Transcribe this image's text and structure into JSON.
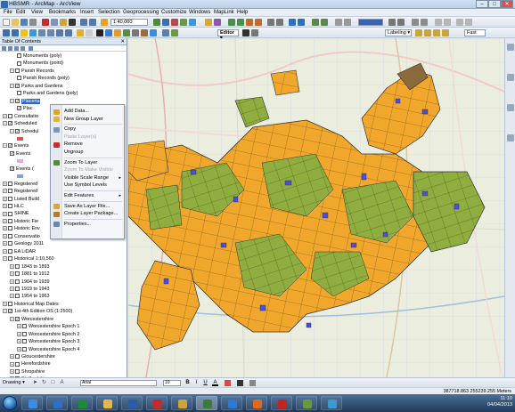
{
  "window": {
    "title": "HBSMR - ArcMap - ArcView",
    "minimize": "–",
    "maximize": "□",
    "close": "✕"
  },
  "menu": [
    "File",
    "Edit",
    "View",
    "Bookmarks",
    "Insert",
    "Selection",
    "Geoprocessing",
    "Customize",
    "Windows",
    "MapLink",
    "Help"
  ],
  "toolbar": {
    "scale": "1:40,000",
    "editor_label": "Editor ▾",
    "labeling_label": "Labeling ▾",
    "fast_label": "Fast"
  },
  "toc": {
    "title": "Table Of Contents",
    "close": "✕",
    "rows": [
      {
        "indent": 2,
        "pm": "",
        "cb": "",
        "label": "Monuments (poly)"
      },
      {
        "indent": 2,
        "pm": "",
        "cb": "",
        "label": "Monuments (point)"
      },
      {
        "indent": 1,
        "pm": "−",
        "cb": "",
        "label": "Parish Records"
      },
      {
        "indent": 2,
        "pm": "",
        "cb": "",
        "label": "Parish Records (poly)"
      },
      {
        "indent": 1,
        "pm": "−",
        "cb": "✓",
        "label": "Parks and Gardens"
      },
      {
        "indent": 2,
        "pm": "",
        "cb": "",
        "label": "Parks and Gardens (poly)"
      },
      {
        "indent": 1,
        "pm": "−",
        "cb": "✓",
        "label": "Placena",
        "sel": true
      },
      {
        "indent": 2,
        "pm": "",
        "cb": "✓",
        "label": "Plac"
      },
      {
        "indent": 0,
        "pm": "+",
        "cb": "",
        "label": "Consultatio"
      },
      {
        "indent": 0,
        "pm": "−",
        "cb": "✓",
        "label": "Scheduled"
      },
      {
        "indent": 1,
        "pm": "−",
        "cb": "✓",
        "label": "Schedul"
      },
      {
        "indent": 2,
        "pm": "",
        "cb": "",
        "label": "",
        "swatch": "#e84c4c"
      },
      {
        "indent": 0,
        "pm": "−",
        "cb": "✓",
        "label": "Events"
      },
      {
        "indent": 1,
        "pm": "",
        "cb": "✓",
        "label": "Events"
      },
      {
        "indent": 2,
        "pm": "",
        "cb": "",
        "label": "",
        "swatch": "#e7a5e8"
      },
      {
        "indent": 1,
        "pm": "",
        "cb": "✓",
        "label": "Events ("
      },
      {
        "indent": 2,
        "pm": "",
        "cb": "",
        "label": "",
        "swatch": "#7fa3dd"
      },
      {
        "indent": 0,
        "pm": "+",
        "cb": "",
        "label": "Registered"
      },
      {
        "indent": 0,
        "pm": "+",
        "cb": "",
        "label": "Registered"
      },
      {
        "indent": 0,
        "pm": "+",
        "cb": "",
        "label": "Listed Build"
      },
      {
        "indent": 0,
        "pm": "+",
        "cb": "",
        "label": "HLC"
      },
      {
        "indent": 0,
        "pm": "+",
        "cb": "",
        "label": "SHINE"
      },
      {
        "indent": 0,
        "pm": "+",
        "cb": "",
        "label": "Historic Fie"
      },
      {
        "indent": 0,
        "pm": "+",
        "cb": "",
        "label": "Historic Env"
      },
      {
        "indent": 0,
        "pm": "+",
        "cb": "",
        "label": "Conservatio"
      },
      {
        "indent": 0,
        "pm": "+",
        "cb": "",
        "label": "Geology 2011"
      },
      {
        "indent": 0,
        "pm": "+",
        "cb": "",
        "label": "EA LiDAR"
      },
      {
        "indent": 0,
        "pm": "−",
        "cb": "",
        "label": "Historical 1:10,560"
      },
      {
        "indent": 1,
        "pm": "+",
        "cb": "",
        "label": "1843 to 1893"
      },
      {
        "indent": 1,
        "pm": "+",
        "cb": "",
        "label": "1881 to 1912"
      },
      {
        "indent": 1,
        "pm": "+",
        "cb": "",
        "label": "1904 to 1939"
      },
      {
        "indent": 1,
        "pm": "+",
        "cb": "",
        "label": "1919 to 1943"
      },
      {
        "indent": 1,
        "pm": "+",
        "cb": "",
        "label": "1954 to 1963"
      },
      {
        "indent": 0,
        "pm": "+",
        "cb": "",
        "label": "Historical Map Dates"
      },
      {
        "indent": 0,
        "pm": "−",
        "cb": "✓",
        "label": "1st-4th Edition OS (1:2500)"
      },
      {
        "indent": 1,
        "pm": "−",
        "cb": "✓",
        "label": "Worcestershire"
      },
      {
        "indent": 2,
        "pm": "+",
        "cb": "",
        "label": "Worcestershire Epoch 1"
      },
      {
        "indent": 2,
        "pm": "+",
        "cb": "",
        "label": "Worcestershire Epoch 2"
      },
      {
        "indent": 2,
        "pm": "+",
        "cb": "",
        "label": "Worcestershire Epoch 3"
      },
      {
        "indent": 2,
        "pm": "+",
        "cb": "",
        "label": "Worcestershire Epoch 4"
      },
      {
        "indent": 1,
        "pm": "+",
        "cb": "",
        "label": "Gloucestershire"
      },
      {
        "indent": 1,
        "pm": "+",
        "cb": "",
        "label": "Herefordshire"
      },
      {
        "indent": 1,
        "pm": "+",
        "cb": "",
        "label": "Shropshire"
      },
      {
        "indent": 1,
        "pm": "+",
        "cb": "",
        "label": "Staffordshire"
      }
    ]
  },
  "context_menu": {
    "items": [
      {
        "label": "Add Data...",
        "icon": "add-data-icon",
        "color": "#e0a526"
      },
      {
        "label": "New Group Layer",
        "icon": "group-layer-icon",
        "color": "#d9b44a"
      },
      {
        "sep": true
      },
      {
        "label": "Copy",
        "icon": "copy-icon",
        "color": "#7c95b8"
      },
      {
        "label": "Paste Layer(s)",
        "disabled": true
      },
      {
        "label": "Remove",
        "icon": "remove-icon",
        "color": "#c03030"
      },
      {
        "label": "Ungroup"
      },
      {
        "sep": true
      },
      {
        "label": "Zoom To Layer",
        "icon": "zoom-layer-icon",
        "color": "#4f8a3a"
      },
      {
        "label": "Zoom To Make Visible",
        "disabled": true
      },
      {
        "label": "Visible Scale Range",
        "submenu": true
      },
      {
        "label": "Use Symbol Levels"
      },
      {
        "sep": true
      },
      {
        "label": "Edit Features",
        "submenu": true
      },
      {
        "sep": true
      },
      {
        "label": "Save As Layer File...",
        "icon": "save-layer-icon",
        "color": "#d7a63a"
      },
      {
        "label": "Create Layer Package...",
        "icon": "layer-package-icon",
        "color": "#b37b2e"
      },
      {
        "sep": true
      },
      {
        "label": "Properties...",
        "icon": "properties-icon",
        "color": "#6b87ad"
      }
    ]
  },
  "drawing": {
    "label": "Drawing ▾",
    "font": "Arial",
    "size": "10",
    "bold": "B",
    "italic": "I",
    "underline": "U",
    "font_color": "A"
  },
  "status": {
    "coords": "387718.863  255239.255 Meters"
  },
  "taskbar": {
    "time": "11:10",
    "date": "04/04/2013",
    "apps": [
      {
        "name": "ie-icon",
        "color": "#3a8de0"
      },
      {
        "name": "outlook-icon",
        "color": "#2f6fc2"
      },
      {
        "name": "excel-icon",
        "color": "#1f8a3e"
      },
      {
        "name": "explorer-icon",
        "color": "#e6b84a"
      },
      {
        "name": "word-icon",
        "color": "#2b5aa6"
      },
      {
        "name": "acrobat-icon",
        "color": "#c62b2b"
      },
      {
        "name": "notes-icon",
        "color": "#c9a53c"
      },
      {
        "name": "arcmap-icon",
        "color": "#3b7a3b"
      },
      {
        "name": "ie2-icon",
        "color": "#2c7ad4"
      },
      {
        "name": "firefox-icon",
        "color": "#e06a1c"
      },
      {
        "name": "acrobat2-icon",
        "color": "#c42222"
      },
      {
        "name": "arccatalog-icon",
        "color": "#6a9a3d"
      },
      {
        "name": "globe-icon",
        "color": "#3c9ad0"
      }
    ]
  },
  "colors": {
    "pasture": "#8fae3f",
    "arable": "#f1a72c",
    "water": "#4a4fd4",
    "woodland": "#7a5a2a",
    "selection": "#3166c2"
  }
}
